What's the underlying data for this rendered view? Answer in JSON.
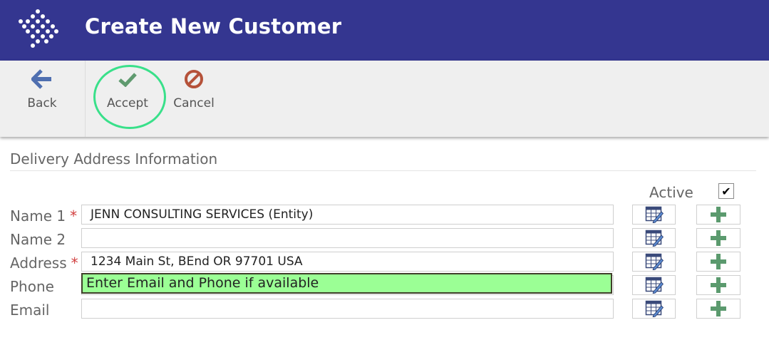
{
  "header": {
    "title": "Create New Customer",
    "logo_icon": "diamond-dots-logo-icon"
  },
  "toolbar": {
    "back": {
      "label": "Back",
      "icon": "arrow-left-icon"
    },
    "accept": {
      "label": "Accept",
      "icon": "checkmark-icon"
    },
    "cancel": {
      "label": "Cancel",
      "icon": "no-entry-icon"
    }
  },
  "section": {
    "title": "Delivery Address Information"
  },
  "active": {
    "label": "Active",
    "checked": true,
    "mark": "✔"
  },
  "rows": [
    {
      "label": "Name 1",
      "required": true,
      "value": "JENN CONSULTING SERVICES (Entity)"
    },
    {
      "label": "Name 2",
      "required": false,
      "value": ""
    },
    {
      "label": "Address",
      "required": true,
      "value": "1234 Main St, BEnd OR 97701  USA"
    },
    {
      "label": "Phone",
      "required": false,
      "value": ""
    },
    {
      "label": "Email",
      "required": false,
      "value": ""
    }
  ],
  "required_marker": "*",
  "hint": "Enter Email and Phone if available",
  "colors": {
    "header": "#343690",
    "accent_ring": "#39e08a",
    "hint_bg": "#9bff95",
    "plus": "#5b9a6e",
    "required": "#d24040"
  }
}
